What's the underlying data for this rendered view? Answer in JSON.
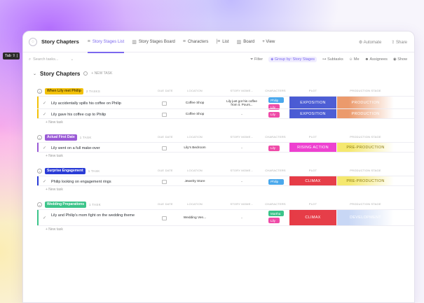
{
  "topbar": {
    "list_name": "Story Chapters",
    "tabs": [
      {
        "label": "Story Stages List",
        "active": true
      },
      {
        "label": "Story Stages Board",
        "active": false
      },
      {
        "label": "Characters",
        "active": false
      },
      {
        "label": "List",
        "active": false
      },
      {
        "label": "Board",
        "active": false
      },
      {
        "label": "+ View",
        "active": false
      }
    ],
    "automate": "Automate",
    "share": "Share"
  },
  "filterbar": {
    "search_placeholder": "Search tasks...",
    "filter": "Filter",
    "group_by": "Group by: Story Stages",
    "subtasks": "Subtasks",
    "me": "Me",
    "assignees": "Assignees",
    "show": "Show"
  },
  "tooltip": "Tab ⇧ |",
  "header": {
    "title": "Story Chapters",
    "new_task": "+ NEW TASK"
  },
  "columns": {
    "due_date": "DUE DATE",
    "location": "LOCATION",
    "story_moment": "STORY MOME...",
    "characters": "CHARACTERS",
    "plot": "PLOT",
    "production": "PRODUCTION STAGE"
  },
  "new_task_row": "+ New task",
  "colors": {
    "accent": "#7b68ee",
    "exposition": "#4a5bd4",
    "rising_action": "#ee3fd0",
    "climax": "#e63b46",
    "production": "#eb9a6c",
    "pre_production": "#f5e86f",
    "development": "#c8d7f5"
  },
  "groups": [
    {
      "name": "When Lily met Philip",
      "color": "#f2c10a",
      "text_color": "#5a4500",
      "count": "2 TASKS",
      "rows": [
        {
          "task": "Lily accidentally spills his coffee on Philip",
          "location": "Coffee Shop",
          "story": "Lily just got his coffee from it. Pours...",
          "characters": [
            {
              "name": "Philip",
              "color": "#4aa8ec"
            },
            {
              "name": "Lily",
              "color": "#ef4ba8"
            }
          ],
          "plot": "EXPOSITION",
          "plot_color": "#4a5bd4",
          "production": "PRODUCTION",
          "prod_color": "#eb9a6c"
        },
        {
          "task": "Lily gave his coffee cup to Philip",
          "location": "Coffee Shop",
          "story": "-",
          "characters": [
            {
              "name": "Lily",
              "color": "#ef4ba8"
            }
          ],
          "plot": "EXPOSITION",
          "plot_color": "#4a5bd4",
          "production": "PRODUCTION",
          "prod_color": "#eb9a6c"
        }
      ]
    },
    {
      "name": "Actual First Date",
      "color": "#9a5ad6",
      "text_color": "#ffffff",
      "count": "1 TASK",
      "rows": [
        {
          "task": "Lily went on a full make-over",
          "location": "Lily's Bedroom",
          "story": "-",
          "characters": [
            {
              "name": "Lily",
              "color": "#ef4ba8"
            }
          ],
          "plot": "RISING ACTION",
          "plot_color": "#ee3fd0",
          "production": "PRE-PRODUCTION",
          "prod_color": "#f5e86f"
        }
      ]
    },
    {
      "name": "Surprise Engagement",
      "color": "#2a3cd6",
      "text_color": "#ffffff",
      "count": "1 TASK",
      "rows": [
        {
          "task": "Philip looking on engagement rings",
          "location": "Jewelry Store",
          "story": "-",
          "characters": [
            {
              "name": "Philip",
              "color": "#4aa8ec"
            }
          ],
          "plot": "CLIMAX",
          "plot_color": "#e63b46",
          "production": "PRE-PRODUCTION",
          "prod_color": "#f5e86f"
        }
      ]
    },
    {
      "name": "Wedding Preparations",
      "color": "#3cc48a",
      "text_color": "#ffffff",
      "count": "1 TASK",
      "rows": [
        {
          "task": "Lily and Philip's mom fight on the wedding theme",
          "location": "Wedding Ven...",
          "story": "-",
          "characters": [
            {
              "name": "Martha",
              "color": "#3cc48a"
            },
            {
              "name": "Lily",
              "color": "#ef4ba8"
            }
          ],
          "plot": "CLIMAX",
          "plot_color": "#e63b46",
          "production": "DEVELOPMENT",
          "prod_color": "#c8d7f5"
        }
      ]
    }
  ]
}
